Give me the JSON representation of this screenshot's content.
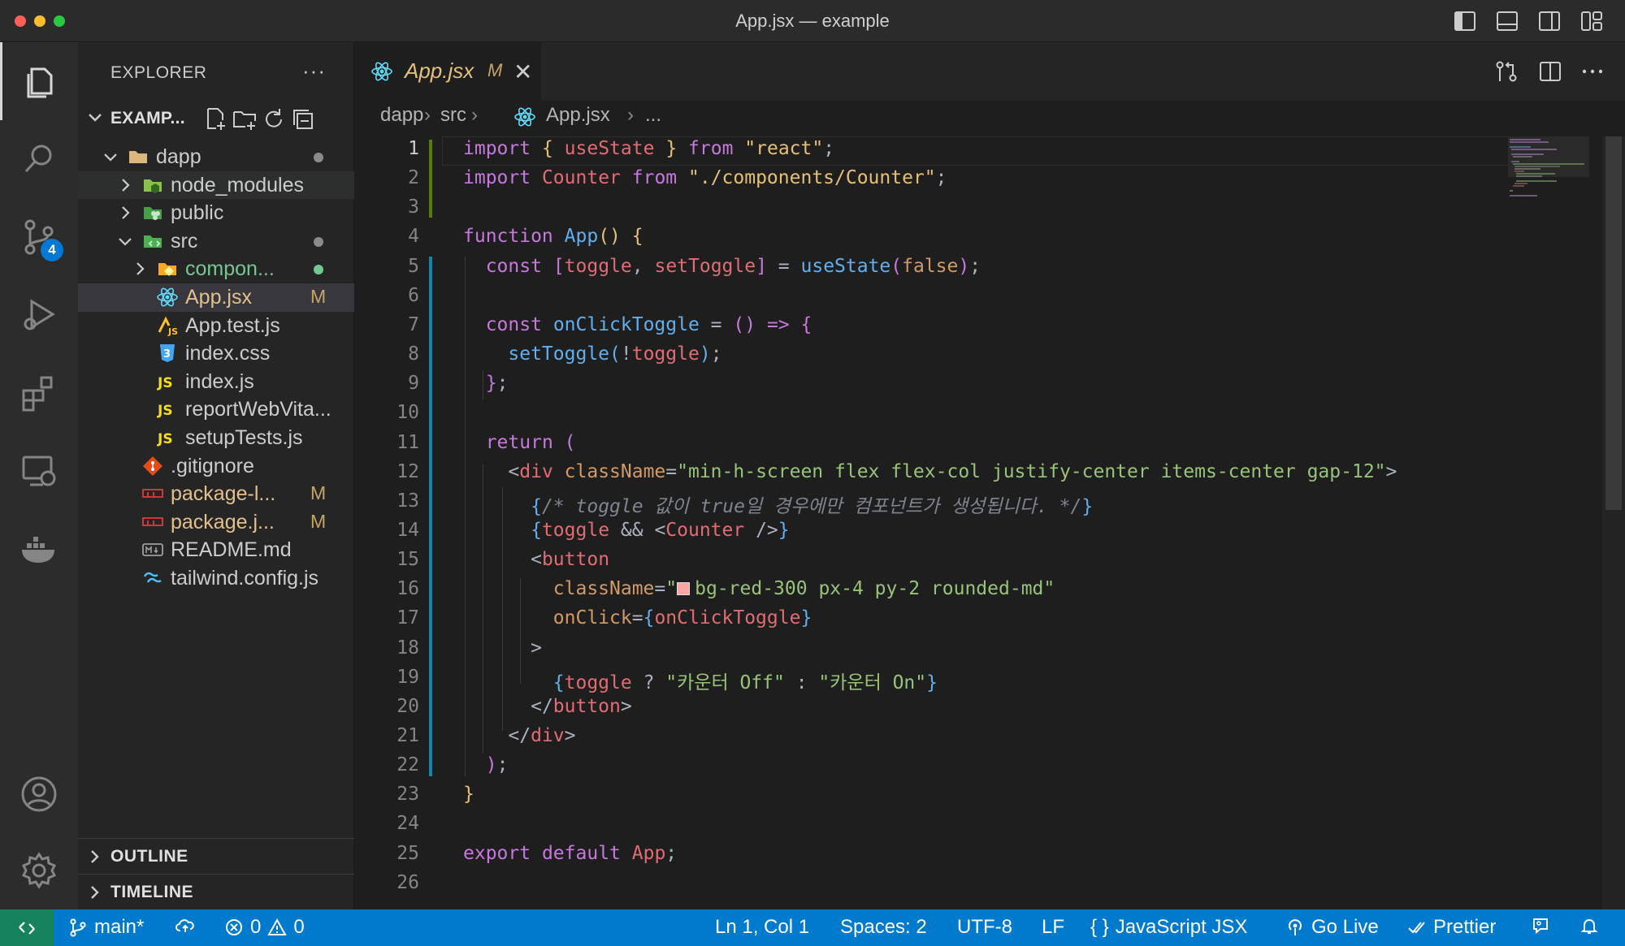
{
  "window": {
    "title": "App.jsx — example"
  },
  "activity_bar": {
    "items": [
      "explorer-icon",
      "search-icon",
      "source-control-icon",
      "run-debug-icon",
      "extensions-icon",
      "remote-explorer-icon",
      "docker-icon"
    ],
    "scm_badge": "4",
    "bottom": [
      "account-icon",
      "settings-gear-icon"
    ]
  },
  "sidebar": {
    "title": "EXPLORER",
    "more": "···",
    "root": "EXAMP...",
    "tree": [
      {
        "label": "dapp",
        "depth": 1,
        "expanded": true,
        "icon": "folder-icon",
        "dot": "#8a8a8a"
      },
      {
        "label": "node_modules",
        "depth": 2,
        "expanded": false,
        "icon": "node-folder-icon"
      },
      {
        "label": "public",
        "depth": 2,
        "expanded": false,
        "icon": "public-folder-icon"
      },
      {
        "label": "src",
        "depth": 2,
        "expanded": true,
        "icon": "src-folder-icon",
        "dot": "#8a8a8a"
      },
      {
        "label": "compon...",
        "depth": 3,
        "expanded": false,
        "icon": "components-folder-icon",
        "dot": "#73c991"
      },
      {
        "label": "App.jsx",
        "depth": 3,
        "icon": "react-icon",
        "badge": "M"
      },
      {
        "label": "App.test.js",
        "depth": 3,
        "icon": "test-js-icon"
      },
      {
        "label": "index.css",
        "depth": 3,
        "icon": "css-icon"
      },
      {
        "label": "index.js",
        "depth": 3,
        "icon": "js-icon"
      },
      {
        "label": "reportWebVita...",
        "depth": 3,
        "icon": "js-icon"
      },
      {
        "label": "setupTests.js",
        "depth": 3,
        "icon": "js-icon"
      },
      {
        "label": ".gitignore",
        "depth": 2,
        "icon": "git-icon"
      },
      {
        "label": "package-l...",
        "depth": 2,
        "icon": "npm-icon",
        "badge": "M"
      },
      {
        "label": "package.j...",
        "depth": 2,
        "icon": "npm-icon",
        "badge": "M"
      },
      {
        "label": "README.md",
        "depth": 2,
        "icon": "markdown-icon"
      },
      {
        "label": "tailwind.config.js",
        "depth": 2,
        "icon": "tailwind-icon"
      }
    ],
    "outline": "OUTLINE",
    "timeline": "TIMELINE"
  },
  "editor": {
    "tab": {
      "label": "App.jsx",
      "modified": "M",
      "close": "✕"
    },
    "breadcrumb": [
      "dapp",
      "src",
      "App.jsx",
      "..."
    ],
    "separator": "›",
    "lines": [
      [
        [
          "kw",
          "import"
        ],
        [
          "plain",
          " "
        ],
        [
          "br1",
          "{"
        ],
        [
          "plain",
          " "
        ],
        [
          "var",
          "useState"
        ],
        [
          "plain",
          " "
        ],
        [
          "br1",
          "}"
        ],
        [
          "plain",
          " "
        ],
        [
          "kw",
          "from"
        ],
        [
          "plain",
          " "
        ],
        [
          "str",
          "\"react\""
        ],
        [
          "plain",
          ";"
        ]
      ],
      [
        [
          "kw",
          "import"
        ],
        [
          "plain",
          " "
        ],
        [
          "var",
          "Counter"
        ],
        [
          "plain",
          " "
        ],
        [
          "kw",
          "from"
        ],
        [
          "plain",
          " "
        ],
        [
          "str",
          "\"./components/Counter\""
        ],
        [
          "plain",
          ";"
        ]
      ],
      [],
      [
        [
          "kw",
          "function"
        ],
        [
          "plain",
          " "
        ],
        [
          "fn",
          "App"
        ],
        [
          "br1",
          "()"
        ],
        [
          "plain",
          " "
        ],
        [
          "br1",
          "{"
        ]
      ],
      [
        [
          "plain",
          "  "
        ],
        [
          "kw",
          "const"
        ],
        [
          "plain",
          " "
        ],
        [
          "br2",
          "["
        ],
        [
          "var",
          "toggle"
        ],
        [
          "plain",
          ", "
        ],
        [
          "var",
          "setToggle"
        ],
        [
          "br2",
          "]"
        ],
        [
          "plain",
          " = "
        ],
        [
          "fn",
          "useState"
        ],
        [
          "br2",
          "("
        ],
        [
          "attr",
          "false"
        ],
        [
          "br2",
          ")"
        ],
        [
          "plain",
          ";"
        ]
      ],
      [],
      [
        [
          "plain",
          "  "
        ],
        [
          "kw",
          "const"
        ],
        [
          "plain",
          " "
        ],
        [
          "fn",
          "onClickToggle"
        ],
        [
          "plain",
          " = "
        ],
        [
          "br2",
          "()"
        ],
        [
          "plain",
          " "
        ],
        [
          "kw",
          "=>"
        ],
        [
          "plain",
          " "
        ],
        [
          "br2",
          "{"
        ]
      ],
      [
        [
          "plain",
          "    "
        ],
        [
          "fn",
          "setToggle"
        ],
        [
          "br3",
          "("
        ],
        [
          "plain",
          "!"
        ],
        [
          "var",
          "toggle"
        ],
        [
          "br3",
          ")"
        ],
        [
          "plain",
          ";"
        ]
      ],
      [
        [
          "plain",
          "  "
        ],
        [
          "br2",
          "}"
        ],
        [
          "plain",
          ";"
        ]
      ],
      [],
      [
        [
          "plain",
          "  "
        ],
        [
          "kw",
          "return"
        ],
        [
          "plain",
          " "
        ],
        [
          "br2",
          "("
        ]
      ],
      [
        [
          "plain",
          "    "
        ],
        [
          "plain",
          "<"
        ],
        [
          "tag",
          "div"
        ],
        [
          "plain",
          " "
        ],
        [
          "attr",
          "className"
        ],
        [
          "plain",
          "="
        ],
        [
          "str2",
          "\"min-h-screen flex flex-col justify-center items-center gap-12\""
        ],
        [
          "plain",
          ">"
        ]
      ],
      [
        [
          "plain",
          "      "
        ],
        [
          "br3",
          "{"
        ],
        [
          "comment",
          "/* toggle 값이 true일 경우에만 컴포넌트가 생성됩니다. */"
        ],
        [
          "br3",
          "}"
        ]
      ],
      [
        [
          "plain",
          "      "
        ],
        [
          "br3",
          "{"
        ],
        [
          "var",
          "toggle"
        ],
        [
          "plain",
          " && "
        ],
        [
          "plain",
          "<"
        ],
        [
          "tag",
          "Counter"
        ],
        [
          "plain",
          " />"
        ],
        [
          "br3",
          "}"
        ]
      ],
      [
        [
          "plain",
          "      "
        ],
        [
          "plain",
          "<"
        ],
        [
          "tag",
          "button"
        ]
      ],
      [
        [
          "plain",
          "        "
        ],
        [
          "attr",
          "className"
        ],
        [
          "plain",
          "="
        ],
        [
          "str2",
          "\""
        ],
        [
          "swatch",
          ""
        ],
        [
          "str2",
          "bg-red-300 px-4 py-2 rounded-md\""
        ]
      ],
      [
        [
          "plain",
          "        "
        ],
        [
          "attr",
          "onClick"
        ],
        [
          "plain",
          "="
        ],
        [
          "br3",
          "{"
        ],
        [
          "var",
          "onClickToggle"
        ],
        [
          "br3",
          "}"
        ]
      ],
      [
        [
          "plain",
          "      "
        ],
        [
          "plain",
          ">"
        ]
      ],
      [
        [
          "plain",
          "        "
        ],
        [
          "br3",
          "{"
        ],
        [
          "var",
          "toggle"
        ],
        [
          "plain",
          " ? "
        ],
        [
          "str2",
          "\"카운터 Off\""
        ],
        [
          "plain",
          " : "
        ],
        [
          "str2",
          "\"카운터 On\""
        ],
        [
          "br3",
          "}"
        ]
      ],
      [
        [
          "plain",
          "      "
        ],
        [
          "plain",
          "</"
        ],
        [
          "tag",
          "button"
        ],
        [
          "plain",
          ">"
        ]
      ],
      [
        [
          "plain",
          "    "
        ],
        [
          "plain",
          "</"
        ],
        [
          "tag",
          "div"
        ],
        [
          "plain",
          ">"
        ]
      ],
      [
        [
          "plain",
          "  "
        ],
        [
          "br2",
          ")"
        ],
        [
          "plain",
          ";"
        ]
      ],
      [
        [
          "br1",
          "}"
        ]
      ],
      [],
      [
        [
          "kw",
          "export"
        ],
        [
          "plain",
          " "
        ],
        [
          "kw",
          "default"
        ],
        [
          "plain",
          " "
        ],
        [
          "var",
          "App"
        ],
        [
          "plain",
          ";"
        ]
      ],
      []
    ],
    "current_line": 1
  },
  "statusbar": {
    "branch": "main*",
    "errors": "0",
    "warnings": "0",
    "position": "Ln 1, Col 1",
    "spaces": "Spaces: 2",
    "encoding": "UTF-8",
    "eol": "LF",
    "language_braces": "{ }",
    "language": "JavaScript JSX",
    "golive": "Go Live",
    "prettier": "Prettier"
  },
  "colors": {
    "accent": "#007acc",
    "remote": "#16825d",
    "modified": "#c8a467",
    "keyword": "#c678dd",
    "string": "#e5c07b"
  }
}
